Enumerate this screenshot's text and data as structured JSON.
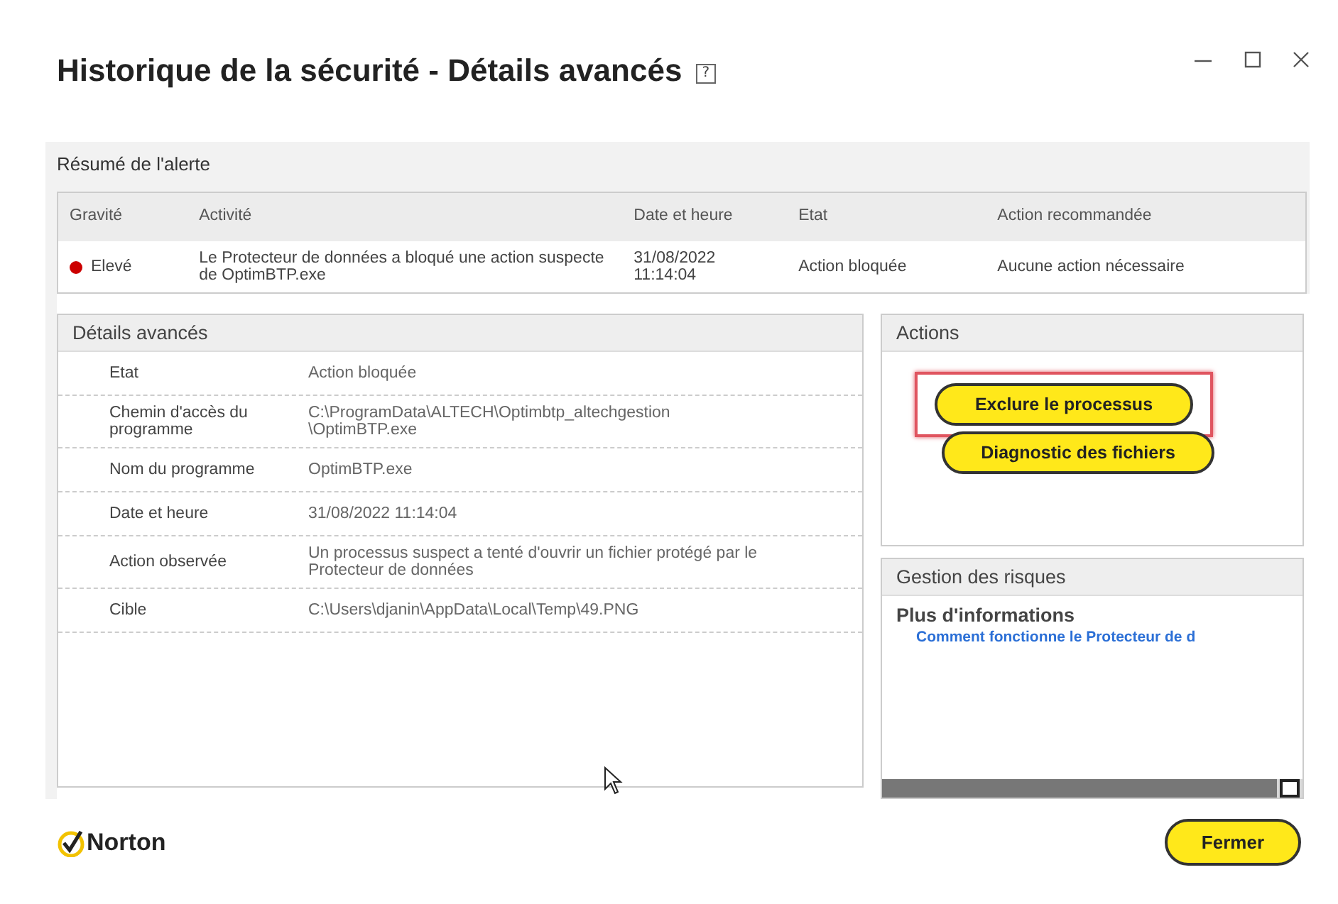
{
  "window": {
    "title": "Historique de la sécurité - Détails avancés",
    "help": "?"
  },
  "summary": {
    "heading": "Résumé de l'alerte",
    "columns": [
      "Gravité",
      "Activité",
      "Date et heure",
      "Etat",
      "Action recommandée"
    ],
    "rows": [
      {
        "severity": "Elevé",
        "color": "#cc0000",
        "activity": "Le Protecteur de données a bloqué une action suspecte de OptimBTP.exe",
        "date": "31/08/2022 11:14:04",
        "state": "Action bloquée",
        "recommended": "Aucune action nécessaire"
      }
    ]
  },
  "details": {
    "heading": "Détails avancés",
    "rows": [
      {
        "label": "Etat",
        "value": "Action bloquée"
      },
      {
        "label": "Chemin d'accès du programme",
        "value": "C:\\ProgramData\\ALTECH\\Optimbtp_altechgestion \\OptimBTP.exe"
      },
      {
        "label": "Nom du programme",
        "value": "OptimBTP.exe"
      },
      {
        "label": "Date et heure",
        "value": "31/08/2022 11:14:04"
      },
      {
        "label": "Action observée",
        "value": "Un processus suspect a tenté d'ouvrir un fichier protégé par le Protecteur de données"
      },
      {
        "label": "Cible",
        "value": "C:\\Users\\djanin\\AppData\\Local\\Temp\\49.PNG"
      }
    ]
  },
  "actions": {
    "heading": "Actions",
    "buttons": [
      {
        "label": "Exclure le processus",
        "highlighted": true
      },
      {
        "label": "Diagnostic des fichiers",
        "highlighted": false
      }
    ]
  },
  "risk": {
    "heading": "Gestion des risques",
    "subheading": "Plus d'informations",
    "link": "Comment fonctionne le Protecteur de d"
  },
  "footer": {
    "brand": "Norton",
    "close_button": "Fermer"
  }
}
